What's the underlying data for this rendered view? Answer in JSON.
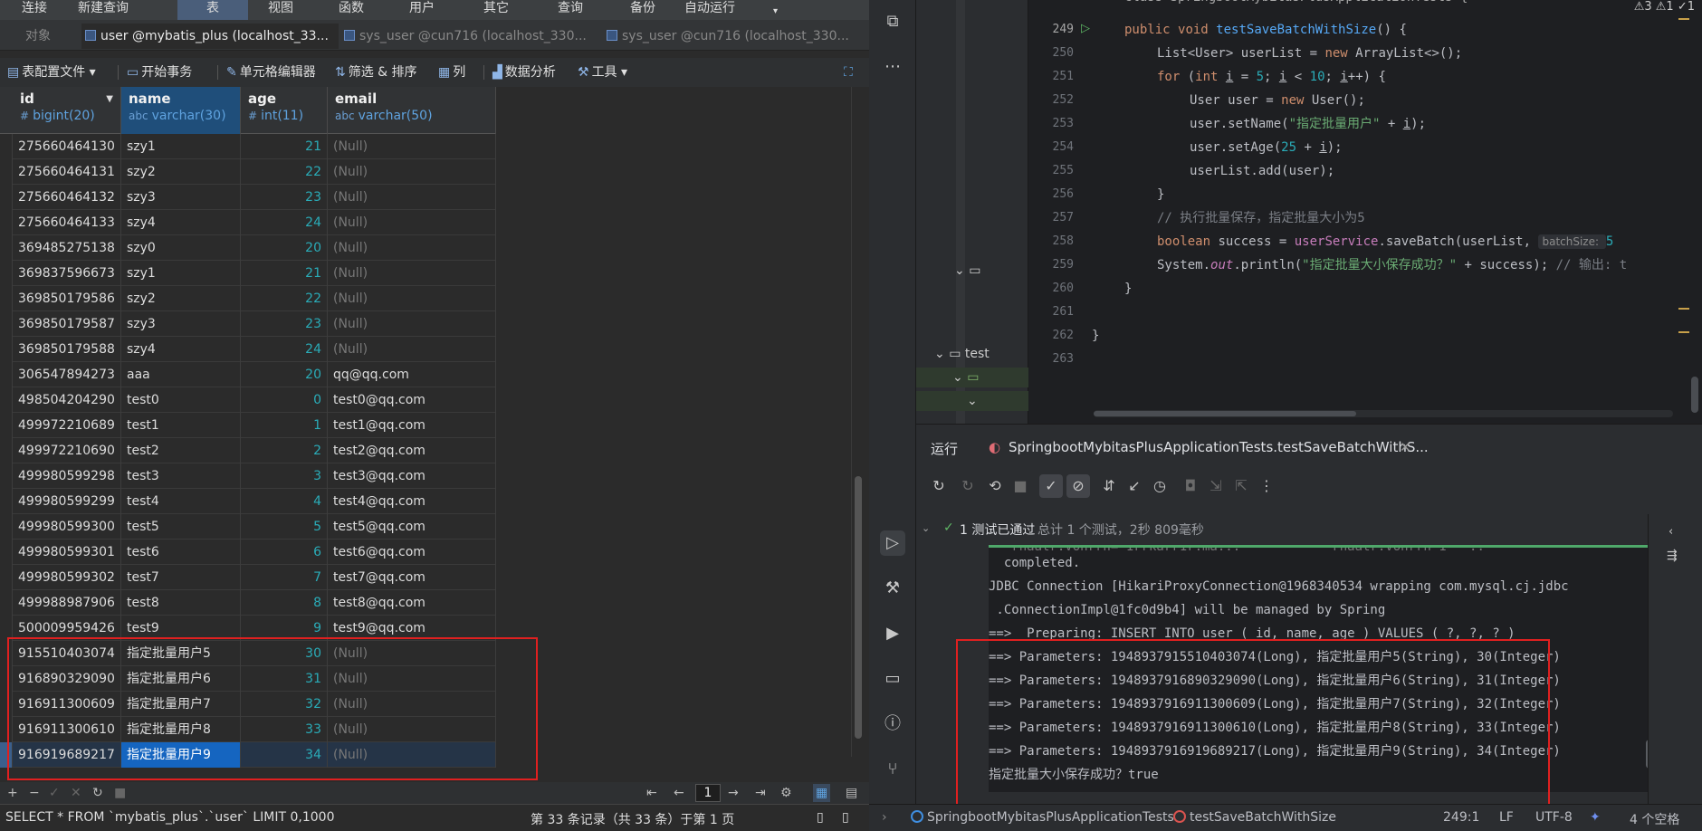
{
  "navicat": {
    "menu": [
      "连接",
      "新建查询",
      "表",
      "视图",
      "函数",
      "用户",
      "其它",
      "查询",
      "备份",
      "自动运行"
    ],
    "menu_active": "表",
    "tabs": [
      {
        "label": "对象"
      },
      {
        "label": "user @mybatis_plus (localhost_33..."
      },
      {
        "label": "sys_user @cun716 (localhost_330..."
      },
      {
        "label": "sys_user @cun716 (localhost_330..."
      }
    ],
    "toolbar": [
      "表配置文件",
      "开始事务",
      "单元格编辑器",
      "筛选 & 排序",
      "列",
      "数据分析",
      "工具"
    ],
    "columns": [
      {
        "name": "id",
        "type": "bigint(20)",
        "icon": "#"
      },
      {
        "name": "name",
        "type": "varchar(30)",
        "icon": "abc"
      },
      {
        "name": "age",
        "type": "int(11)",
        "icon": "#"
      },
      {
        "name": "email",
        "type": "varchar(50)",
        "icon": "abc"
      }
    ],
    "rows": [
      [
        "275660464130",
        "szy1",
        "21",
        "(Null)"
      ],
      [
        "275660464131",
        "szy2",
        "22",
        "(Null)"
      ],
      [
        "275660464132",
        "szy3",
        "23",
        "(Null)"
      ],
      [
        "275660464133",
        "szy4",
        "24",
        "(Null)"
      ],
      [
        "369485275138",
        "szy0",
        "20",
        "(Null)"
      ],
      [
        "369837596673",
        "szy1",
        "21",
        "(Null)"
      ],
      [
        "369850179586",
        "szy2",
        "22",
        "(Null)"
      ],
      [
        "369850179587",
        "szy3",
        "23",
        "(Null)"
      ],
      [
        "369850179588",
        "szy4",
        "24",
        "(Null)"
      ],
      [
        "306547894273",
        "aaa",
        "20",
        "qq@qq.com"
      ],
      [
        "498504204290",
        "test0",
        "0",
        "test0@qq.com"
      ],
      [
        "499972210689",
        "test1",
        "1",
        "test1@qq.com"
      ],
      [
        "499972210690",
        "test2",
        "2",
        "test2@qq.com"
      ],
      [
        "499980599298",
        "test3",
        "3",
        "test3@qq.com"
      ],
      [
        "499980599299",
        "test4",
        "4",
        "test4@qq.com"
      ],
      [
        "499980599300",
        "test5",
        "5",
        "test5@qq.com"
      ],
      [
        "499980599301",
        "test6",
        "6",
        "test6@qq.com"
      ],
      [
        "499980599302",
        "test7",
        "7",
        "test7@qq.com"
      ],
      [
        "499988987906",
        "test8",
        "8",
        "test8@qq.com"
      ],
      [
        "500009959426",
        "test9",
        "9",
        "test9@qq.com"
      ],
      [
        "915510403074",
        "指定批量用户5",
        "30",
        "(Null)"
      ],
      [
        "916890329090",
        "指定批量用户6",
        "31",
        "(Null)"
      ],
      [
        "916911300609",
        "指定批量用户7",
        "32",
        "(Null)"
      ],
      [
        "916911300610",
        "指定批量用户8",
        "33",
        "(Null)"
      ],
      [
        "916919689217",
        "指定批量用户9",
        "34",
        "(Null)"
      ]
    ],
    "selected_row": 24,
    "page_number": "1",
    "sql": "SELECT * FROM `mybatis_plus`.`user` LIMIT 0,1000",
    "record_info": "第 33 条记录（共 33 条）于第 1 页"
  },
  "ide": {
    "top_info": "⚠3  ⚠1  ✓1",
    "class_header": "class SpringbootMybitasPlusApplicationTests {",
    "project": {
      "test_folder": "test"
    },
    "line_numbers": [
      "249",
      "250",
      "251",
      "252",
      "253",
      "254",
      "255",
      "256",
      "257",
      "258",
      "259",
      "260",
      "261",
      "262",
      "263"
    ],
    "code": {
      "l249": [
        "public ",
        "void ",
        "testSaveBatchWithSize",
        "() {"
      ],
      "l250": [
        "List<User> userList = ",
        "new ",
        "ArrayList<>();"
      ],
      "l251": [
        "for ",
        "(",
        "int ",
        "i",
        " = ",
        "5",
        "; ",
        "i",
        " < ",
        "10",
        "; ",
        "i",
        "++) {"
      ],
      "l252": [
        "User user = ",
        "new ",
        "User();"
      ],
      "l253": [
        "user.setName(",
        "\"指定批量用户\"",
        " + ",
        "i",
        ");"
      ],
      "l254": [
        "user.setAge(",
        "25",
        " + ",
        "i",
        ");"
      ],
      "l255": [
        "userList.add(user);"
      ],
      "l256": [
        "}"
      ],
      "l257": [
        "// 执行批量保存，指定批量大小为5"
      ],
      "l258": [
        "boolean ",
        "success = ",
        "userService",
        ".saveBatch(userList, ",
        "batchSize: ",
        "5"
      ],
      "l259": [
        "System.",
        "out",
        ".println(",
        "\"指定批量大小保存成功？\"",
        " + success); ",
        "// 输出: t"
      ],
      "l260": [
        "}"
      ],
      "l262": [
        "}"
      ]
    },
    "run": {
      "label": "运行",
      "tab_title": "SpringbootMybitasPlusApplicationTests.testSaveBatchWithS...",
      "test_status": "1 测试已通过",
      "test_summary": "总计 1 个测试，2秒 809毫秒",
      "console": [
        "  completed.",
        "JDBC Connection [HikariProxyConnection@1968340534 wrapping com.mysql.cj.jdbc",
        " .ConnectionImpl@1fc0d9b4] will be managed by Spring",
        "==>  Preparing: INSERT INTO user ( id, name, age ) VALUES ( ?, ?, ? )",
        "==> Parameters: 1948937915510403074(Long), 指定批量用户5(String), 30(Integer)",
        "==> Parameters: 1948937916890329090(Long), 指定批量用户6(String), 31(Integer)",
        "==> Parameters: 1948937916911300609(Long), 指定批量用户7(String), 32(Integer)",
        "==> Parameters: 1948937916911300610(Long), 指定批量用户8(String), 33(Integer)",
        "==> Parameters: 1948937916919689217(Long), 指定批量用户9(String), 34(Integer)",
        "指定批量大小保存成功？true"
      ]
    },
    "status": {
      "breadcrumb_class": "SpringbootMybitasPlusApplicationTests",
      "breadcrumb_method": "testSaveBatchWithSize",
      "position": "249:1",
      "line_ending": "LF",
      "encoding": "UTF-8",
      "indent": "4 个空格"
    }
  }
}
